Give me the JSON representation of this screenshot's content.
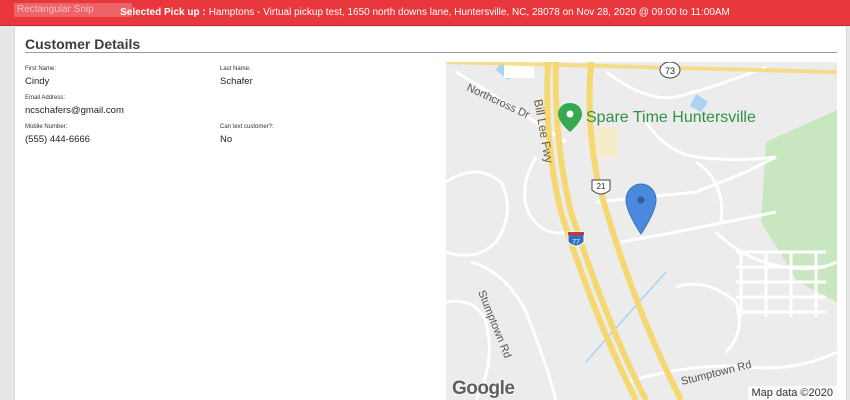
{
  "window": {
    "snip_label": "Rectangular Snip"
  },
  "banner": {
    "label": "Selected Pick up :",
    "text": "Hamptons - Virtual pickup test, 1650 north downs lane, Huntersville, NC, 28078 on Nov 28, 2020 @ 09:00 to 11:00AM"
  },
  "customer": {
    "title": "Customer Details",
    "first_name": {
      "label": "First Name:",
      "value": "Cindy"
    },
    "last_name": {
      "label": "Last Name:",
      "value": "Schafer"
    },
    "email": {
      "label": "Email Address:",
      "value": "ncschafers@gmail.com"
    },
    "mobile": {
      "label": "Mobile Number:",
      "value": "(555) 444-6666"
    },
    "can_text": {
      "label": "Can text customer?:",
      "value": "No"
    }
  },
  "map": {
    "road_labels": {
      "northcross": "Northcross Dr",
      "bill_lee": "Bill Lee Fwy",
      "stumptown_left": "Stumptown Rd",
      "stumptown_right": "Stumptown Rd"
    },
    "shields": {
      "route_73": "73",
      "us_21": "21",
      "i_77": "77"
    },
    "poi_label": "Spare Time Huntersville",
    "logo": "Google",
    "attribution": "Map data ©2020",
    "colors": {
      "highway": "#f6d873",
      "water": "#aad3f2",
      "park": "#c8e6c0",
      "poi": "#34a853",
      "marker": "#4a89dc"
    }
  }
}
